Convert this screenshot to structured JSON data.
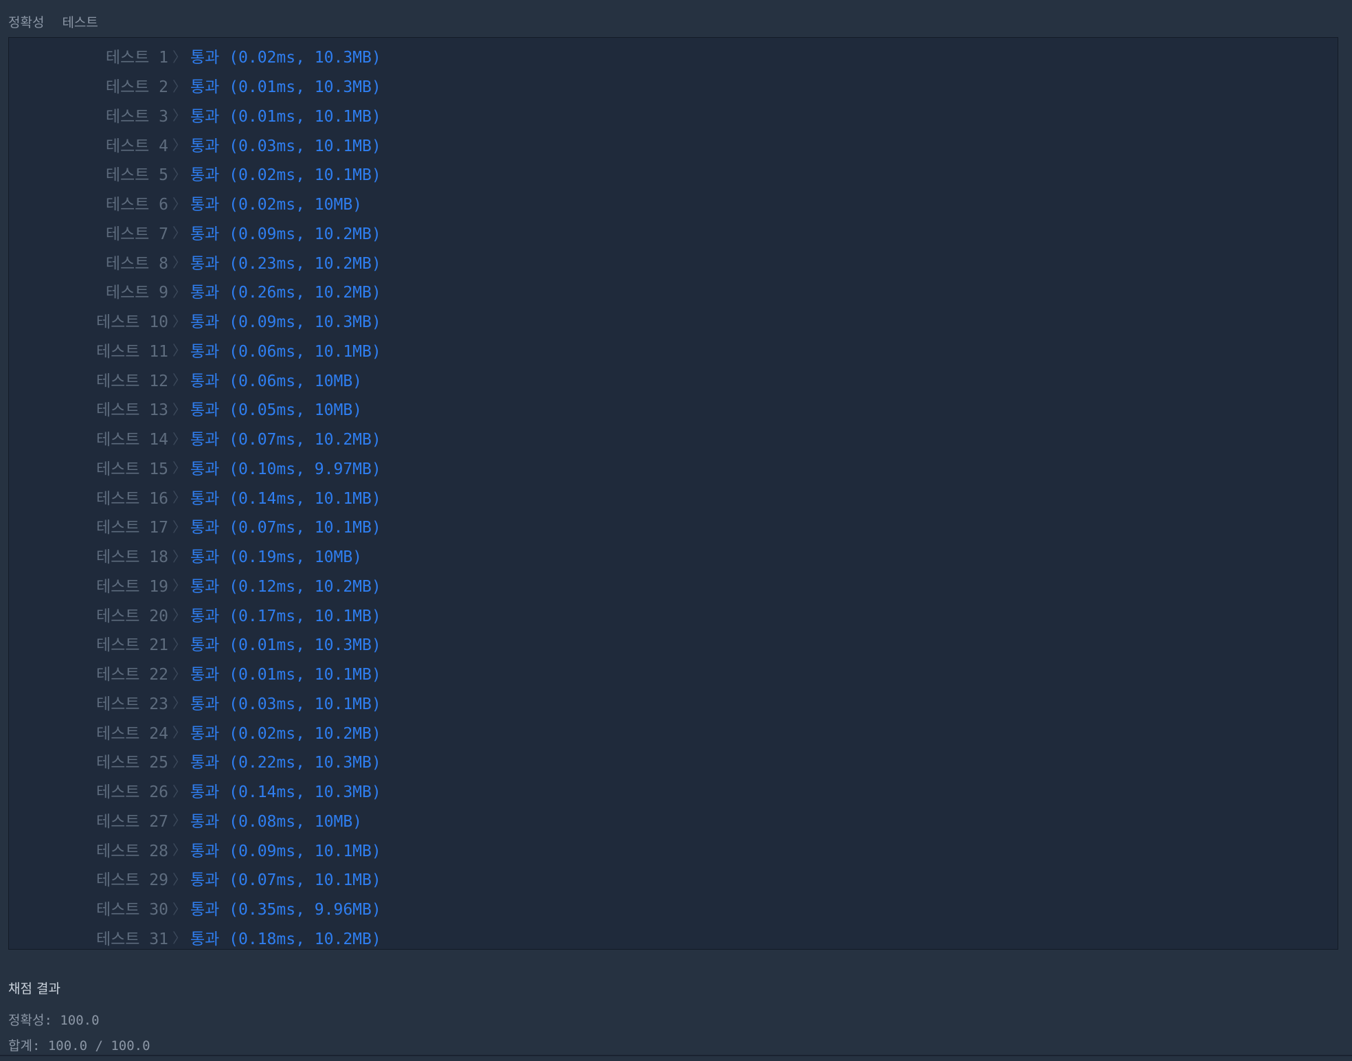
{
  "tabs": [
    {
      "label": "정확성"
    },
    {
      "label": "테스트"
    }
  ],
  "results": [
    {
      "label": "테스트 1",
      "result": "통과 (0.02ms, 10.3MB)"
    },
    {
      "label": "테스트 2",
      "result": "통과 (0.01ms, 10.3MB)"
    },
    {
      "label": "테스트 3",
      "result": "통과 (0.01ms, 10.1MB)"
    },
    {
      "label": "테스트 4",
      "result": "통과 (0.03ms, 10.1MB)"
    },
    {
      "label": "테스트 5",
      "result": "통과 (0.02ms, 10.1MB)"
    },
    {
      "label": "테스트 6",
      "result": "통과 (0.02ms, 10MB)"
    },
    {
      "label": "테스트 7",
      "result": "통과 (0.09ms, 10.2MB)"
    },
    {
      "label": "테스트 8",
      "result": "통과 (0.23ms, 10.2MB)"
    },
    {
      "label": "테스트 9",
      "result": "통과 (0.26ms, 10.2MB)"
    },
    {
      "label": "테스트 10",
      "result": "통과 (0.09ms, 10.3MB)"
    },
    {
      "label": "테스트 11",
      "result": "통과 (0.06ms, 10.1MB)"
    },
    {
      "label": "테스트 12",
      "result": "통과 (0.06ms, 10MB)"
    },
    {
      "label": "테스트 13",
      "result": "통과 (0.05ms, 10MB)"
    },
    {
      "label": "테스트 14",
      "result": "통과 (0.07ms, 10.2MB)"
    },
    {
      "label": "테스트 15",
      "result": "통과 (0.10ms, 9.97MB)"
    },
    {
      "label": "테스트 16",
      "result": "통과 (0.14ms, 10.1MB)"
    },
    {
      "label": "테스트 17",
      "result": "통과 (0.07ms, 10.1MB)"
    },
    {
      "label": "테스트 18",
      "result": "통과 (0.19ms, 10MB)"
    },
    {
      "label": "테스트 19",
      "result": "통과 (0.12ms, 10.2MB)"
    },
    {
      "label": "테스트 20",
      "result": "통과 (0.17ms, 10.1MB)"
    },
    {
      "label": "테스트 21",
      "result": "통과 (0.01ms, 10.3MB)"
    },
    {
      "label": "테스트 22",
      "result": "통과 (0.01ms, 10.1MB)"
    },
    {
      "label": "테스트 23",
      "result": "통과 (0.03ms, 10.1MB)"
    },
    {
      "label": "테스트 24",
      "result": "통과 (0.02ms, 10.2MB)"
    },
    {
      "label": "테스트 25",
      "result": "통과 (0.22ms, 10.3MB)"
    },
    {
      "label": "테스트 26",
      "result": "통과 (0.14ms, 10.3MB)"
    },
    {
      "label": "테스트 27",
      "result": "통과 (0.08ms, 10MB)"
    },
    {
      "label": "테스트 28",
      "result": "통과 (0.09ms, 10.1MB)"
    },
    {
      "label": "테스트 29",
      "result": "통과 (0.07ms, 10.1MB)"
    },
    {
      "label": "테스트 30",
      "result": "통과 (0.35ms, 9.96MB)"
    },
    {
      "label": "테스트 31",
      "result": "통과 (0.18ms, 10.2MB)"
    }
  ],
  "summary": {
    "title": "채점 결과",
    "accuracy": "정확성: 100.0",
    "total": "합계: 100.0 / 100.0"
  },
  "colors": {
    "page_bg": "#263241",
    "panel_bg": "#1f2a3b",
    "pass_text": "#2f7ef0",
    "label_text": "#5e6c7e"
  },
  "icons": {
    "row_separator": "chevron-right-icon"
  }
}
